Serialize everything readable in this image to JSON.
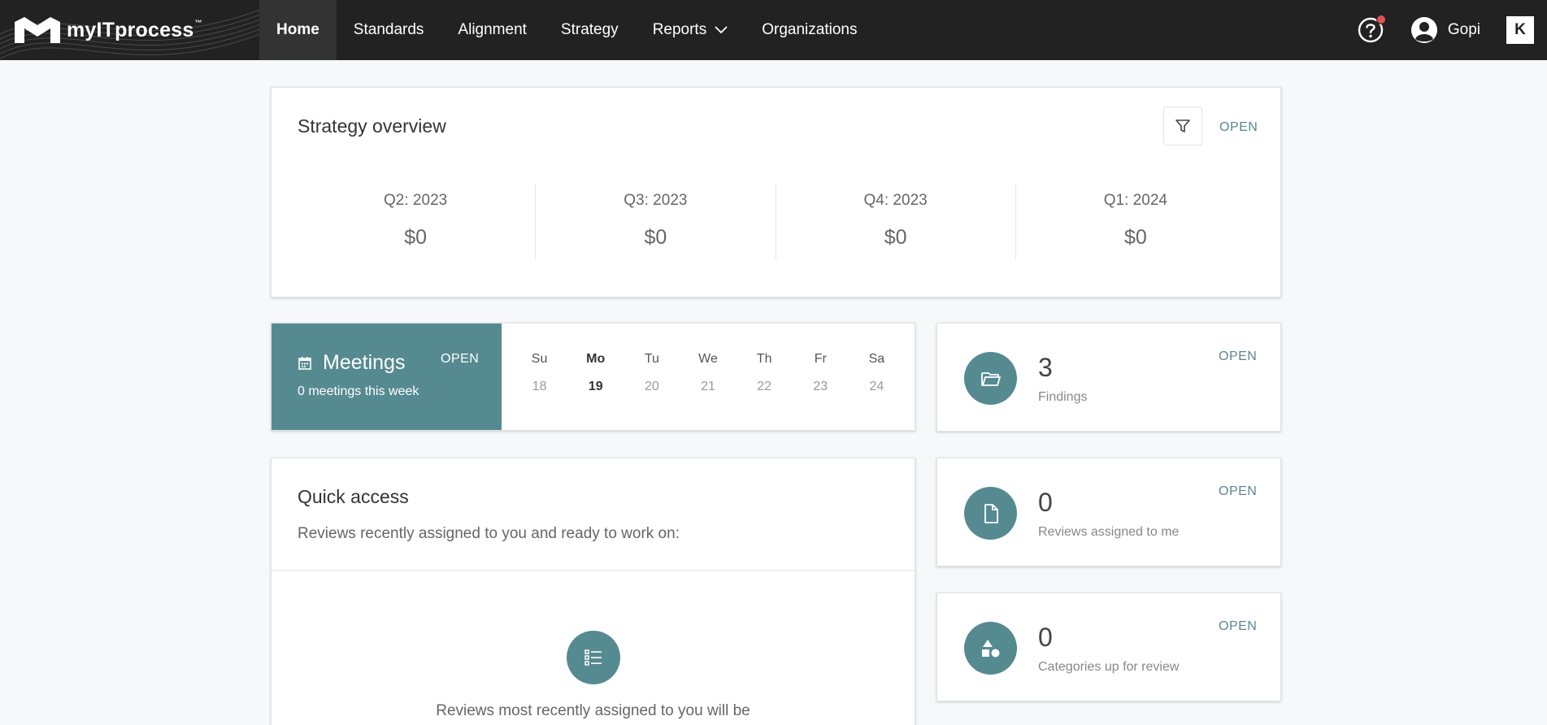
{
  "brand": {
    "name": "myITprocess",
    "tm": "™"
  },
  "nav": {
    "items": [
      {
        "label": "Home"
      },
      {
        "label": "Standards"
      },
      {
        "label": "Alignment"
      },
      {
        "label": "Strategy"
      },
      {
        "label": "Reports"
      },
      {
        "label": "Organizations"
      }
    ],
    "active": "Home"
  },
  "user": {
    "name": "Gopi",
    "app_badge": "K"
  },
  "icons": {
    "help": "help-circle-icon",
    "notification_dot_color": "#e05252",
    "accent": "#568a91"
  },
  "strategy": {
    "title": "Strategy overview",
    "open_label": "OPEN",
    "quarters": [
      {
        "label": "Q2: 2023",
        "value": "$0"
      },
      {
        "label": "Q3: 2023",
        "value": "$0"
      },
      {
        "label": "Q4: 2023",
        "value": "$0"
      },
      {
        "label": "Q1: 2024",
        "value": "$0"
      }
    ]
  },
  "meetings": {
    "title": "Meetings",
    "subtitle": "0 meetings this week",
    "open_label": "OPEN",
    "days": [
      {
        "name": "Su",
        "date": "18"
      },
      {
        "name": "Mo",
        "date": "19"
      },
      {
        "name": "Tu",
        "date": "20"
      },
      {
        "name": "We",
        "date": "21"
      },
      {
        "name": "Th",
        "date": "22"
      },
      {
        "name": "Fr",
        "date": "23"
      },
      {
        "name": "Sa",
        "date": "24"
      }
    ],
    "today": "19"
  },
  "stats": [
    {
      "count": "3",
      "label": "Findings",
      "open_label": "OPEN",
      "icon": "folder-open-icon"
    },
    {
      "count": "0",
      "label": "Reviews assigned to me",
      "open_label": "OPEN",
      "icon": "document-icon"
    },
    {
      "count": "0",
      "label": "Categories up for review",
      "open_label": "OPEN",
      "icon": "shapes-icon"
    }
  ],
  "quick_access": {
    "title": "Quick access",
    "subtitle": "Reviews recently assigned to you and ready to work on:",
    "empty_text": "Reviews most recently assigned to you will be"
  }
}
